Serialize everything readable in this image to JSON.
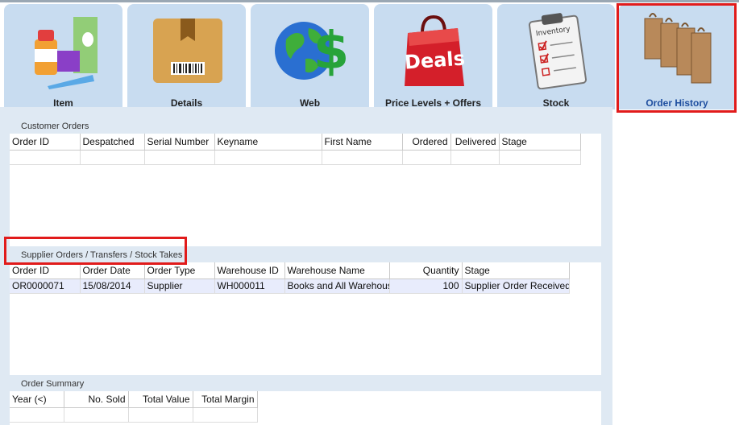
{
  "tabs": [
    {
      "label": "Item",
      "icon": "medicine-bottles-icon"
    },
    {
      "label": "Details",
      "icon": "package-barcode-icon"
    },
    {
      "label": "Web",
      "icon": "globe-dollar-icon"
    },
    {
      "label": "Price Levels + Offers",
      "icon": "deals-bag-icon"
    },
    {
      "label": "Stock",
      "icon": "inventory-clipboard-icon"
    },
    {
      "label": "Order History",
      "icon": "shopping-bags-icon"
    }
  ],
  "customer_orders": {
    "title": "Customer Orders",
    "columns": [
      "Order ID",
      "Despatched",
      "Serial Number",
      "Keyname",
      "First Name",
      "Ordered",
      "Delivered",
      "Stage"
    ],
    "rows": []
  },
  "supplier_orders": {
    "title": "Supplier Orders / Transfers / Stock Takes",
    "columns": [
      "Order ID",
      "Order Date",
      "Order Type",
      "Warehouse ID",
      "Warehouse Name",
      "Quantity",
      "Stage"
    ],
    "rows": [
      [
        "OR0000071",
        "15/08/2014",
        "Supplier",
        "WH000011",
        "Books and All Warehouse",
        "100",
        "Supplier Order Received"
      ]
    ]
  },
  "order_summary": {
    "title": "Order Summary",
    "columns": [
      "Year (<)",
      "No. Sold",
      "Total Value",
      "Total Margin"
    ],
    "rows": []
  },
  "colors": {
    "highlight": "#e11b1b",
    "tab_bg": "#c8dcf0",
    "panel_bg": "#dfe9f3",
    "active_label": "#1f4fa0"
  }
}
